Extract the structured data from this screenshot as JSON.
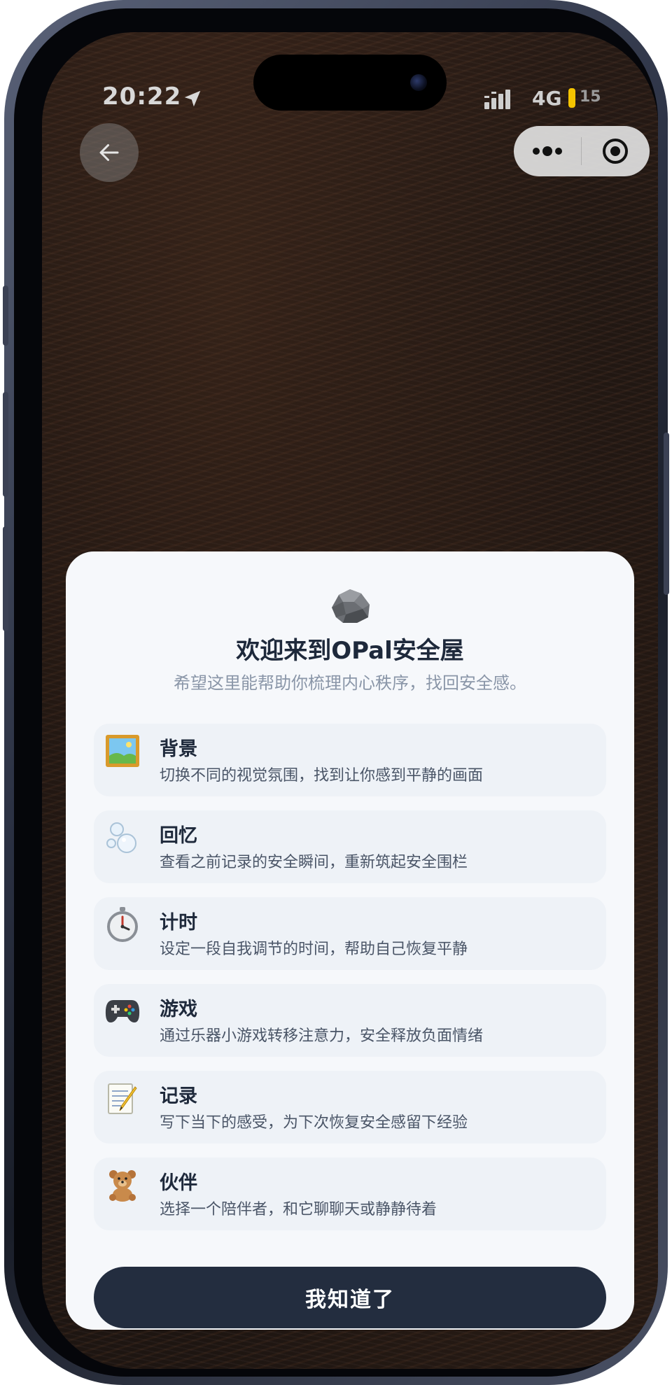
{
  "status_bar": {
    "time": "20:22",
    "network": "4G",
    "battery": "15",
    "icons": [
      "location-arrow-icon",
      "signal-bars-icon",
      "battery-low-icon"
    ]
  },
  "nav": {
    "back_icon": "arrow-left-icon",
    "more_icon": "more-dots-icon",
    "close_icon": "target-circle-icon"
  },
  "dialog": {
    "icon": "rock-icon",
    "title": "欢迎来到OPal安全屋",
    "subtitle": "希望这里能帮助你梳理内心秩序，找回安全感。",
    "features": [
      {
        "icon": "framed-picture-icon",
        "title": "背景",
        "desc": "切换不同的视觉氛围，找到让你感到平静的画面"
      },
      {
        "icon": "bubbles-icon",
        "title": "回忆",
        "desc": "查看之前记录的安全瞬间，重新筑起安全围栏"
      },
      {
        "icon": "stopwatch-icon",
        "title": "计时",
        "desc": "设定一段自我调节的时间，帮助自己恢复平静"
      },
      {
        "icon": "gamepad-icon",
        "title": "游戏",
        "desc": "通过乐器小游戏转移注意力，安全释放负面情绪"
      },
      {
        "icon": "memo-icon",
        "title": "记录",
        "desc": "写下当下的感受，为下次恢复安全感留下经验"
      },
      {
        "icon": "teddy-bear-icon",
        "title": "伙伴",
        "desc": "选择一个陪伴者，和它聊聊天或静静待着"
      }
    ],
    "confirm_label": "我知道了"
  },
  "colors": {
    "card_bg": "#f6f8fb",
    "item_bg": "#eef2f7",
    "button_bg": "#232d3f",
    "title_text": "#1e293b",
    "subtitle_text": "#8a96a8",
    "battery_accent": "#f5c400"
  }
}
